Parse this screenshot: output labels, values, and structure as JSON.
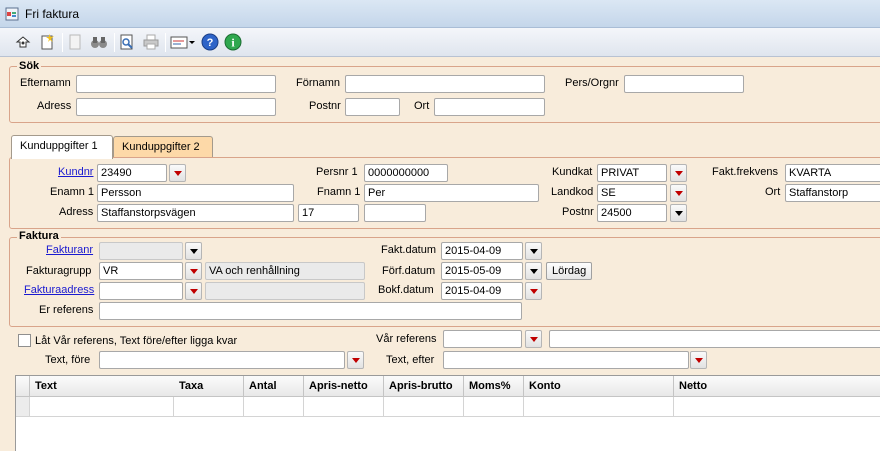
{
  "window": {
    "title": "Fri faktura"
  },
  "toolbar": {
    "icons": [
      "key-icon",
      "new-icon",
      "document-icon",
      "binoculars-icon",
      "print-preview-icon",
      "printer-icon",
      "form-dropdown-icon",
      "help-icon",
      "info-icon"
    ]
  },
  "sok": {
    "title": "Sök",
    "efternamn_label": "Efternamn",
    "efternamn_value": "",
    "fornamn_label": "Förnamn",
    "fornamn_value": "",
    "persorgnr_label": "Pers/Orgnr",
    "persorgnr_value": "",
    "adress_label": "Adress",
    "adress_value": "",
    "postnr_label": "Postnr",
    "postnr_value": "",
    "ort_label": "Ort",
    "ort_value": ""
  },
  "tabs": [
    {
      "label": "Kunduppgifter 1",
      "active": true
    },
    {
      "label": "Kunduppgifter 2",
      "active": false
    }
  ],
  "kund": {
    "kundnr_label": "Kundnr",
    "kundnr_value": "23490",
    "persnr_label": "Persnr 1",
    "persnr_value": "0000000000",
    "kundkat_label": "Kundkat",
    "kundkat_value": "PRIVAT",
    "faktfrekvens_label": "Fakt.frekvens",
    "faktfrekvens_value": "KVARTA",
    "enamn_label": "Enamn 1",
    "enamn_value": "Persson",
    "fnamn_label": "Fnamn 1",
    "fnamn_value": "Per",
    "landkod_label": "Landkod",
    "landkod_value": "SE",
    "ort_label": "Ort",
    "ort_value": "Staffanstorp",
    "adress_label": "Adress",
    "adress_value": "Staffanstorpsvägen",
    "adress_nr": "17",
    "adress_extra": "",
    "postnr_label": "Postnr",
    "postnr_value": "24500"
  },
  "faktura": {
    "title": "Faktura",
    "fakturanr_label": "Fakturanr",
    "fakturanr_value": "",
    "fakturagrupp_label": "Fakturagrupp",
    "fakturagrupp_value": "VR",
    "fakturagrupp_desc": "VA och renhållning",
    "fakturaadress_label": "Fakturaadress",
    "fakturaadress_value": "",
    "fakturaadress_desc": "",
    "erreferens_label": "Er referens",
    "erreferens_value": "",
    "faktdatum_label": "Fakt.datum",
    "faktdatum_value": "2015-04-09",
    "forfdatum_label": "Förf.datum",
    "forfdatum_value": "2015-05-09",
    "forfdatum_day": "Lördag",
    "bokfdatum_label": "Bokf.datum",
    "bokfdatum_value": "2015-04-09"
  },
  "extra": {
    "checkbox_label": "Låt Vår referens, Text före/efter ligga kvar",
    "textfore_label": "Text, före",
    "textfore_value": "",
    "varreferens_label": "Vår referens",
    "varreferens_value": "",
    "varreferens_desc": "",
    "textefter_label": "Text, efter",
    "textefter_value": ""
  },
  "grid": {
    "columns": [
      "Text",
      "Taxa",
      "Antal",
      "Apris-netto",
      "Apris-brutto",
      "Moms%",
      "Konto",
      "Netto"
    ]
  },
  "colors": {
    "background": "#f8ecdb",
    "group_border": "#d9a48a",
    "link": "#1a1ad0",
    "dropdown_arrow": "#c00000"
  }
}
